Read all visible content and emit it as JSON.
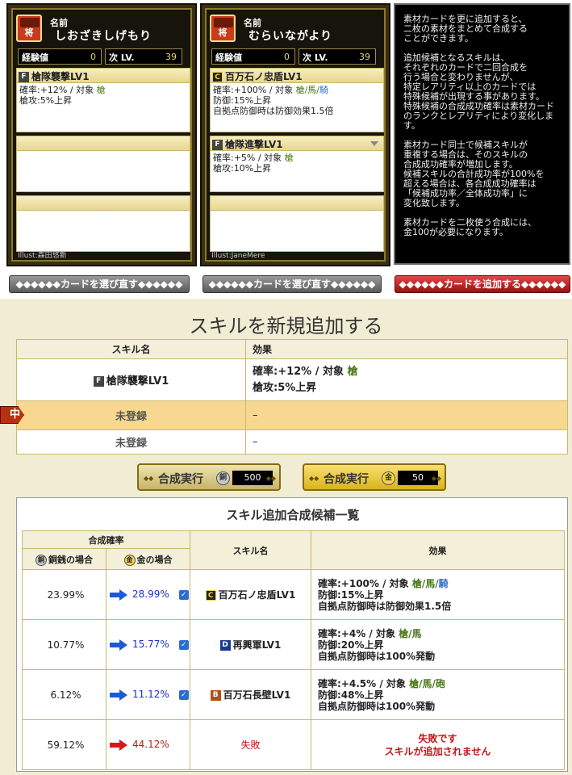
{
  "cards": [
    {
      "name_label": "名前",
      "name": "しおざきしげもり",
      "exp_label": "経験値",
      "exp_value": "0",
      "next_label": "次 LV.",
      "next_value": "39",
      "rank_icon": "将",
      "skill1": {
        "rank": "F",
        "title": "槍隊襲撃LV1",
        "line1_pre": "確率:+12% / 対象 ",
        "line1_tags": "槍",
        "line2": "槍攻:5%上昇"
      },
      "illust": "Illust:森田悠新"
    },
    {
      "name_label": "名前",
      "name": "むらいながより",
      "exp_label": "経験値",
      "exp_value": "0",
      "next_label": "次 LV.",
      "next_value": "39",
      "rank_icon": "将",
      "skill1": {
        "rank": "C",
        "title": "百万石ノ忠盾LV1",
        "line1_pre": "確率:+100% / 対象 ",
        "line1_tags": "槍/馬/",
        "line1_blue": "騎",
        "line2": "防御:15%上昇",
        "line3": "自拠点防御時は防御効果1.5倍"
      },
      "skill2": {
        "rank": "F",
        "title": "槍隊進撃LV1",
        "line1_pre": "確率:+5% / 対象 ",
        "line1_tags": "槍",
        "line2": "槍攻:10%上昇"
      },
      "illust": "Illust:JaneMere"
    }
  ],
  "description": [
    "素材カードを更に追加すると、\n二枚の素材をまとめて合成する\nことができます。",
    "追加候補となるスキルは、\nそれぞれのカードで二回合成を\n行う場合と変わりませんが、\n特定レアリティ以上のカードでは\n特殊候補が出現する事があります。\n特殊候補の合成成功確率は素材カード\nのランクとレアリティにより変化します。",
    "素材カード同士で候補スキルが\n重複する場合は、そのスキルの\n合成成功確率が増加します。\n候補スキルの合計成功率が100%を\n超える場合は、各合成成功確率は\n「候補成功率／全体成功率」に\n変化致します。",
    "素材カードを二枚使う合成には、\n金100が必要になります。"
  ],
  "buttons": {
    "reselect1": "◆◆◆◆◆◆カードを選び直す◆◆◆◆◆◆",
    "reselect2": "◆◆◆◆◆◆カードを選び直す◆◆◆◆◆◆",
    "add_card": "◆◆◆◆◆◆カードを追加する◆◆◆◆◆◆"
  },
  "new_skill": {
    "title": "スキルを新規追加する",
    "col_name": "スキル名",
    "col_effect": "効果",
    "rows": [
      {
        "rank": "F",
        "name": "槍隊襲撃LV1",
        "eff1_pre": "確率:+12% / 対象 ",
        "eff1_tag": "槍",
        "eff2": "槍攻:5%上昇"
      },
      {
        "name": "未登録",
        "effect": "–"
      },
      {
        "name": "未登録",
        "effect": "–"
      }
    ],
    "flag": "中"
  },
  "exec": {
    "copper_label": "合成実行",
    "copper_coin": "銅",
    "copper_cost": "500",
    "gold_label": "合成実行",
    "gold_coin": "金",
    "gold_cost": "50"
  },
  "candidates": {
    "title": "スキル追加合成候補一覧",
    "h_rate": "合成確率",
    "h_copper": "銅銭の場合",
    "h_gold": "金の場合",
    "h_name": "スキル名",
    "h_effect": "効果",
    "coin_copper": "銅",
    "coin_gold": "金",
    "rows": [
      {
        "copper": "23.99%",
        "gold": "28.99%",
        "rank": "C",
        "name": "百万石ノ忠盾LV1",
        "e1_pre": "確率:+100% / 対象 ",
        "e1_tag": "槍/馬/",
        "e1_blue": "騎",
        "e2": "防御:15%上昇",
        "e3": "自拠点防御時は防御効果1.5倍"
      },
      {
        "copper": "10.77%",
        "gold": "15.77%",
        "rank": "D",
        "name": "再興軍LV1",
        "e1_pre": "確率:+4% / 対象 ",
        "e1_tag": "槍/馬",
        "e1_blue": "",
        "e2": "防御:20%上昇",
        "e3": "自拠点防御時は100%発動"
      },
      {
        "copper": "6.12%",
        "gold": "11.12%",
        "rank": "B",
        "name": "百万石長壁LV1",
        "e1_pre": "確率:+4.5% / 対象 ",
        "e1_tag": "槍/馬/砲",
        "e1_blue": "",
        "e2": "防御:48%上昇",
        "e3": "自拠点防御時は100%発動"
      }
    ],
    "fail": {
      "copper": "59.12%",
      "gold": "44.12%",
      "name": "失敗",
      "e1": "失敗です",
      "e2": "スキルが追加されません"
    }
  },
  "colors": {
    "blue_arrow": "#1a5ad8",
    "red_arrow": "#d81818"
  }
}
